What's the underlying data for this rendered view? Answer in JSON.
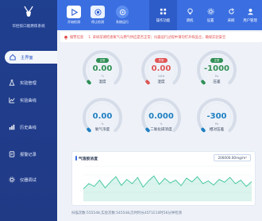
{
  "app": {
    "title": "华控技口能燃炼系统",
    "logo_icon": "antelope-logo-icon"
  },
  "sidebar": {
    "items": [
      {
        "label": "主界面",
        "icon": "home-icon",
        "active": true
      },
      {
        "label": "实验管理",
        "icon": "flask-icon",
        "active": false
      },
      {
        "label": "实验曲线",
        "icon": "line-chart-icon",
        "active": false
      },
      {
        "label": "历史曲线",
        "icon": "history-chart-icon",
        "active": false
      },
      {
        "label": "报警记录",
        "icon": "alarm-record-icon",
        "active": false
      },
      {
        "label": "仪器调试",
        "icon": "debug-gear-icon",
        "active": false
      }
    ]
  },
  "toolbar": {
    "buttons": [
      {
        "label": "开始检测",
        "icon": "play-icon"
      },
      {
        "label": "停止检测",
        "icon": "stop-icon"
      },
      {
        "label": "系统运行",
        "icon": "system-run-icon"
      }
    ],
    "nav": [
      {
        "label": "操作功能",
        "icon": "grid-apps-icon",
        "active": true
      },
      {
        "label": "调机",
        "icon": "lightbulb-icon",
        "active": false
      },
      {
        "label": "设置",
        "icon": "settings-gear-icon",
        "active": false
      },
      {
        "label": "采刷",
        "icon": "refresh-icon",
        "active": false
      },
      {
        "label": "用户管理",
        "icon": "user-icon",
        "active": false
      }
    ]
  },
  "alert": {
    "label": "报警信息",
    "message": "1. 采样前请检查氧气与燃气供应是否正常；仪器运行过程中请勿打开样品仓，确保实验安全"
  },
  "gauges": [
    {
      "name": "温度",
      "value": "0.00",
      "unit": "°C",
      "status": "正常",
      "color": "#2f8f55",
      "level": 0.0
    },
    {
      "name": "湿度",
      "value": "0.00",
      "unit": "%RH",
      "status": "异常",
      "color": "#e05454",
      "level": 0.0
    },
    {
      "name": "压差",
      "value": "-1000",
      "unit": "Pa",
      "status": "正常",
      "color": "#2f8f55",
      "level": 0.0
    },
    {
      "name": "氧气浓度",
      "value": "0.00",
      "unit": "%",
      "status": "",
      "color": "#1f7fc2",
      "level": 0.0
    },
    {
      "name": "二氧化碳浓度",
      "value": "0.000",
      "unit": "%",
      "status": "",
      "color": "#1f7fc2",
      "level": 0.0
    },
    {
      "name": "相对压差",
      "value": "-300",
      "unit": "Pa",
      "status": "",
      "color": "#1f7fc2",
      "level": 0.0
    }
  ],
  "chart_card": {
    "title": "气溶胶浓度",
    "readout": "200000.00mg/m³"
  },
  "chart_data": {
    "type": "area",
    "title": "气溶胶浓度",
    "xlabel": "",
    "ylabel": "",
    "ylim": [
      0,
      1
    ],
    "grid": true,
    "color": "#39c49a",
    "values": [
      0.35,
      0.5,
      0.42,
      0.6,
      0.38,
      0.55,
      0.7,
      0.45,
      0.62,
      0.5,
      0.68,
      0.4,
      0.58,
      0.72,
      0.48,
      0.65,
      0.52,
      0.6,
      0.44,
      0.66,
      0.55,
      0.7,
      0.5,
      0.58,
      0.46,
      0.62,
      0.54,
      0.68,
      0.5,
      0.6,
      0.42,
      0.56
    ]
  },
  "footer": {
    "text": "扫描次数:555548,实验次数:545548,历时时长45T1E10时56分钟检测"
  },
  "colors": {
    "sidebar": "#213a86",
    "topbar": "#3b6fe1",
    "ok": "#2f8f55",
    "warn": "#e05454",
    "accent": "#1f7fc2"
  }
}
